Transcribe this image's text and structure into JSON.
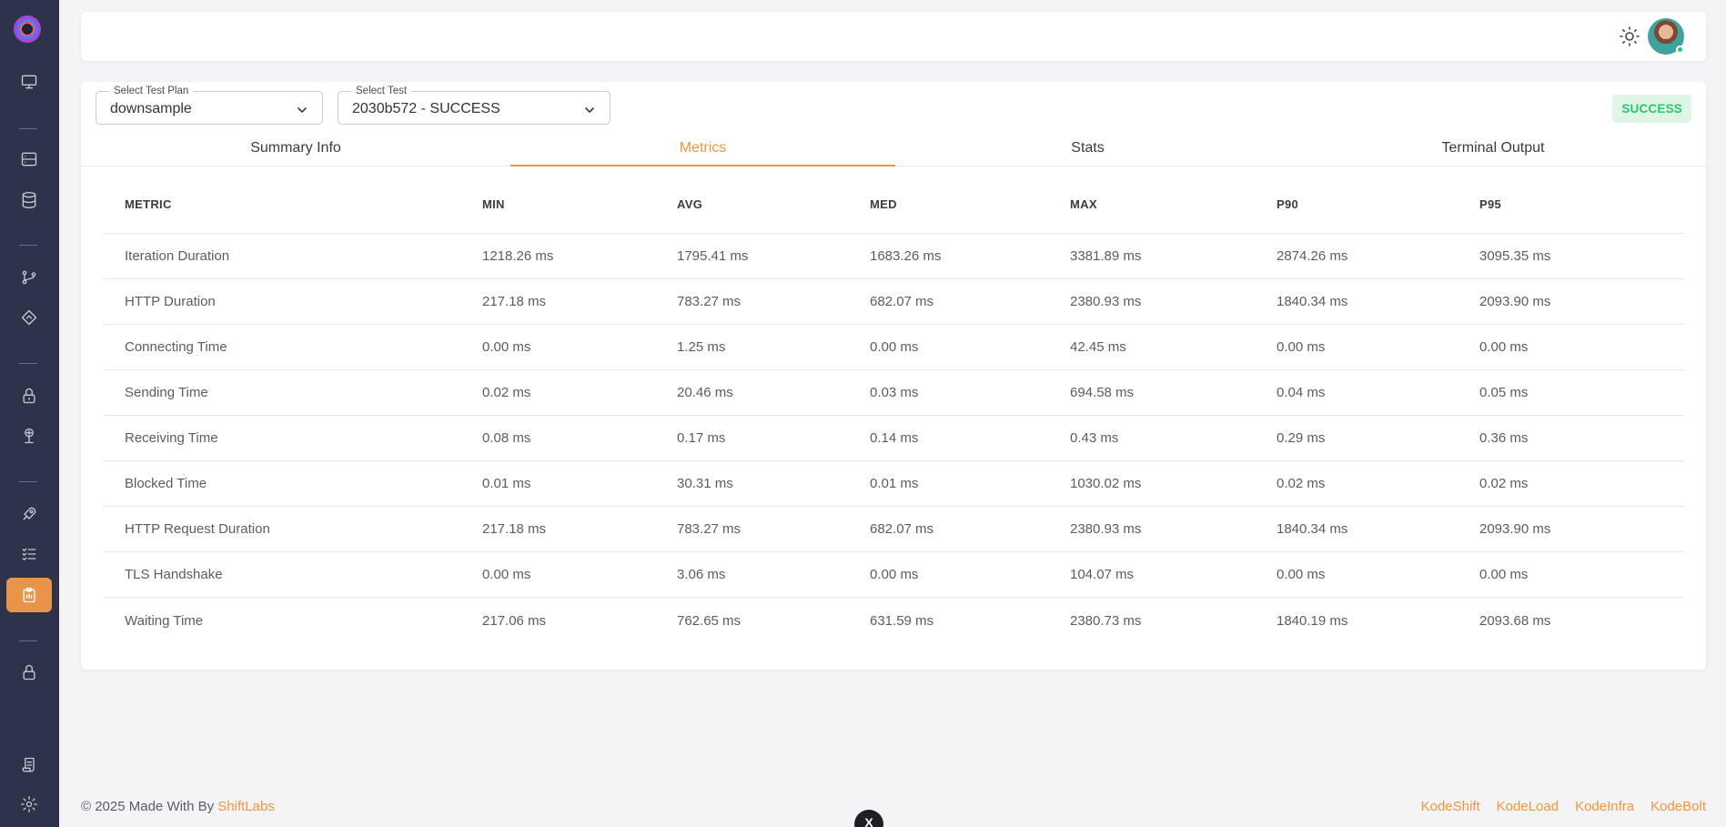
{
  "sidebar": {
    "icons": [
      "logo",
      "monitor-icon",
      "server-icon",
      "database-icon",
      "git-branch-icon",
      "diamond-icon",
      "lock-icon",
      "network-icon",
      "rocket-icon",
      "checklist-icon",
      "clipboard-icon",
      "lock-icon",
      "scroll-icon",
      "gear-icon"
    ],
    "active": "clipboard-icon"
  },
  "filters": {
    "plan_label": "Select Test Plan",
    "plan_value": "downsample",
    "test_label": "Select Test",
    "test_value": "2030b572 - SUCCESS"
  },
  "status_badge": "SUCCESS",
  "tabs": [
    {
      "label": "Summary Info",
      "active": false
    },
    {
      "label": "Metrics",
      "active": true
    },
    {
      "label": "Stats",
      "active": false
    },
    {
      "label": "Terminal Output",
      "active": false
    }
  ],
  "table": {
    "headers": [
      "METRIC",
      "MIN",
      "AVG",
      "MED",
      "MAX",
      "P90",
      "P95"
    ],
    "rows": [
      [
        "Iteration Duration",
        "1218.26 ms",
        "1795.41 ms",
        "1683.26 ms",
        "3381.89 ms",
        "2874.26 ms",
        "3095.35 ms"
      ],
      [
        "HTTP Duration",
        "217.18 ms",
        "783.27 ms",
        "682.07 ms",
        "2380.93 ms",
        "1840.34 ms",
        "2093.90 ms"
      ],
      [
        "Connecting Time",
        "0.00 ms",
        "1.25 ms",
        "0.00 ms",
        "42.45 ms",
        "0.00 ms",
        "0.00 ms"
      ],
      [
        "Sending Time",
        "0.02 ms",
        "20.46 ms",
        "0.03 ms",
        "694.58 ms",
        "0.04 ms",
        "0.05 ms"
      ],
      [
        "Receiving Time",
        "0.08 ms",
        "0.17 ms",
        "0.14 ms",
        "0.43 ms",
        "0.29 ms",
        "0.36 ms"
      ],
      [
        "Blocked Time",
        "0.01 ms",
        "30.31 ms",
        "0.01 ms",
        "1030.02 ms",
        "0.02 ms",
        "0.02 ms"
      ],
      [
        "HTTP Request Duration",
        "217.18 ms",
        "783.27 ms",
        "682.07 ms",
        "2380.93 ms",
        "1840.34 ms",
        "2093.90 ms"
      ],
      [
        "TLS Handshake",
        "0.00 ms",
        "3.06 ms",
        "0.00 ms",
        "104.07 ms",
        "0.00 ms",
        "0.00 ms"
      ],
      [
        "Waiting Time",
        "217.06 ms",
        "762.65 ms",
        "631.59 ms",
        "2380.73 ms",
        "1840.19 ms",
        "2093.68 ms"
      ]
    ]
  },
  "footer": {
    "copyright": "© 2025 Made With By ",
    "brand": "ShiftLabs",
    "links": [
      "KodeShift",
      "KodeLoad",
      "KodeInfra",
      "KodeBolt"
    ]
  },
  "floating_button": "X",
  "colors": {
    "accent": "#f0963a",
    "sidebar": "#2f3349",
    "success": "#28c76f"
  }
}
